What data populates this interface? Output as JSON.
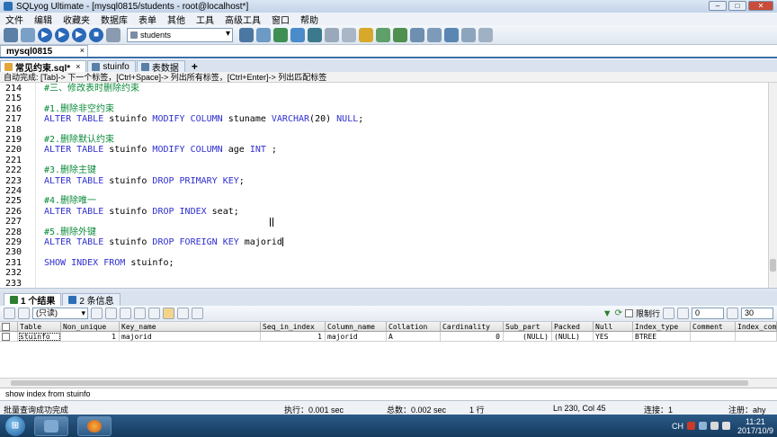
{
  "window": {
    "title": "SQLyog Ultimate - [mysql0815/students - root@localhost*]"
  },
  "menu": [
    "文件",
    "编辑",
    "收藏夹",
    "数据库",
    "表单",
    "其他",
    "工具",
    "高级工具",
    "窗口",
    "帮助"
  ],
  "toolbar": {
    "db_select": "students"
  },
  "connection_tab": {
    "label": "mysql0815",
    "close": "×"
  },
  "query_tabs": [
    {
      "label": "常见约束.sql*",
      "close": "×"
    },
    {
      "label": "stuinfo",
      "close": ""
    },
    {
      "label": "表数据",
      "close": ""
    },
    {
      "label": "+",
      "close": ""
    }
  ],
  "hint": "自动完成: [Tab]-> 下一个标签，[Ctrl+Space]-> 列出所有标签，[Ctrl+Enter]-> 列出匹配标签",
  "editor": {
    "lines": [
      {
        "n": "214",
        "c": [
          {
            "t": "#三、修改表时删除约束",
            "k": "cm"
          }
        ]
      },
      {
        "n": "215",
        "c": []
      },
      {
        "n": "216",
        "c": [
          {
            "t": "#1.删除非空约束",
            "k": "cm"
          }
        ]
      },
      {
        "n": "217",
        "c": [
          {
            "t": "ALTER TABLE ",
            "k": "kw"
          },
          {
            "t": "stuinfo ",
            "k": "tx"
          },
          {
            "t": "MODIFY COLUMN ",
            "k": "kw"
          },
          {
            "t": "stuname ",
            "k": "tx"
          },
          {
            "t": "VARCHAR",
            "k": "kw"
          },
          {
            "t": "(20) ",
            "k": "tx"
          },
          {
            "t": "NULL",
            "k": "kw"
          },
          {
            "t": ";",
            "k": "tx"
          }
        ]
      },
      {
        "n": "218",
        "c": []
      },
      {
        "n": "219",
        "c": [
          {
            "t": "#2.删除默认约束",
            "k": "cm"
          }
        ]
      },
      {
        "n": "220",
        "c": [
          {
            "t": "ALTER TABLE ",
            "k": "kw"
          },
          {
            "t": "stuinfo ",
            "k": "tx"
          },
          {
            "t": "MODIFY COLUMN ",
            "k": "kw"
          },
          {
            "t": "age ",
            "k": "tx"
          },
          {
            "t": "INT",
            "k": "kw"
          },
          {
            "t": " ;",
            "k": "tx"
          }
        ]
      },
      {
        "n": "221",
        "c": []
      },
      {
        "n": "222",
        "c": [
          {
            "t": "#3.删除主键",
            "k": "cm"
          }
        ]
      },
      {
        "n": "223",
        "c": [
          {
            "t": "ALTER TABLE ",
            "k": "kw"
          },
          {
            "t": "stuinfo ",
            "k": "tx"
          },
          {
            "t": "DROP PRIMARY KEY",
            "k": "kw"
          },
          {
            "t": ";",
            "k": "tx"
          }
        ]
      },
      {
        "n": "224",
        "c": []
      },
      {
        "n": "225",
        "c": [
          {
            "t": "#4.删除唯一",
            "k": "cm"
          }
        ]
      },
      {
        "n": "226",
        "c": [
          {
            "t": "ALTER TABLE ",
            "k": "kw"
          },
          {
            "t": "stuinfo ",
            "k": "tx"
          },
          {
            "t": "DROP INDEX ",
            "k": "kw"
          },
          {
            "t": "seat;",
            "k": "tx"
          }
        ]
      },
      {
        "n": "227",
        "c": []
      },
      {
        "n": "228",
        "c": [
          {
            "t": "#5.删除外键",
            "k": "cm"
          }
        ]
      },
      {
        "n": "229",
        "c": [
          {
            "t": "ALTER TABLE ",
            "k": "kw"
          },
          {
            "t": "stuinfo ",
            "k": "tx"
          },
          {
            "t": "DROP FOREIGN KEY ",
            "k": "kw"
          },
          {
            "t": "majorid",
            "k": "tx"
          }
        ]
      },
      {
        "n": "230",
        "c": []
      },
      {
        "n": "231",
        "c": [
          {
            "t": "SHOW INDEX FROM ",
            "k": "kw"
          },
          {
            "t": "stuinfo;",
            "k": "tx"
          }
        ]
      },
      {
        "n": "232",
        "c": []
      },
      {
        "n": "233",
        "c": []
      }
    ]
  },
  "results_tabs": [
    {
      "label": "1 个结果",
      "color": "#2f7d32"
    },
    {
      "label": "2 条信息",
      "color": "#2b6fb5"
    }
  ],
  "results_toolbar": {
    "mode": "(只读)",
    "limit_label": "限制行",
    "offset": "0",
    "count": "30"
  },
  "grid": {
    "columns": [
      "Table",
      "Non_unique",
      "Key_name",
      "Seq_in_index",
      "Column_name",
      "Collation",
      "Cardinality",
      "Sub_part",
      "Packed",
      "Null",
      "Index_type",
      "Comment",
      "Index_com"
    ],
    "rows": [
      [
        "stuinfo",
        "1",
        "majorid",
        "1",
        "majorid",
        "A",
        "0",
        "(NULL)",
        "(NULL)",
        "YES",
        "BTREE",
        "",
        ""
      ]
    ]
  },
  "info_line": "show index from stuinfo",
  "status": {
    "left": "批量查询成功完成",
    "exec": "执行：0.001 sec",
    "total": "总数：0.002 sec",
    "rows": "1 行",
    "pos": "Ln 230, Col 45",
    "conn": "连接：1",
    "reg": "注册：ahy"
  },
  "taskbar": {
    "time": "11:21",
    "date": "2017/10/9",
    "lang": "CH"
  },
  "colors": {
    "keyword": "#2f2fd0",
    "comment": "#0a8a3a",
    "accent": "#3c6ea8"
  }
}
